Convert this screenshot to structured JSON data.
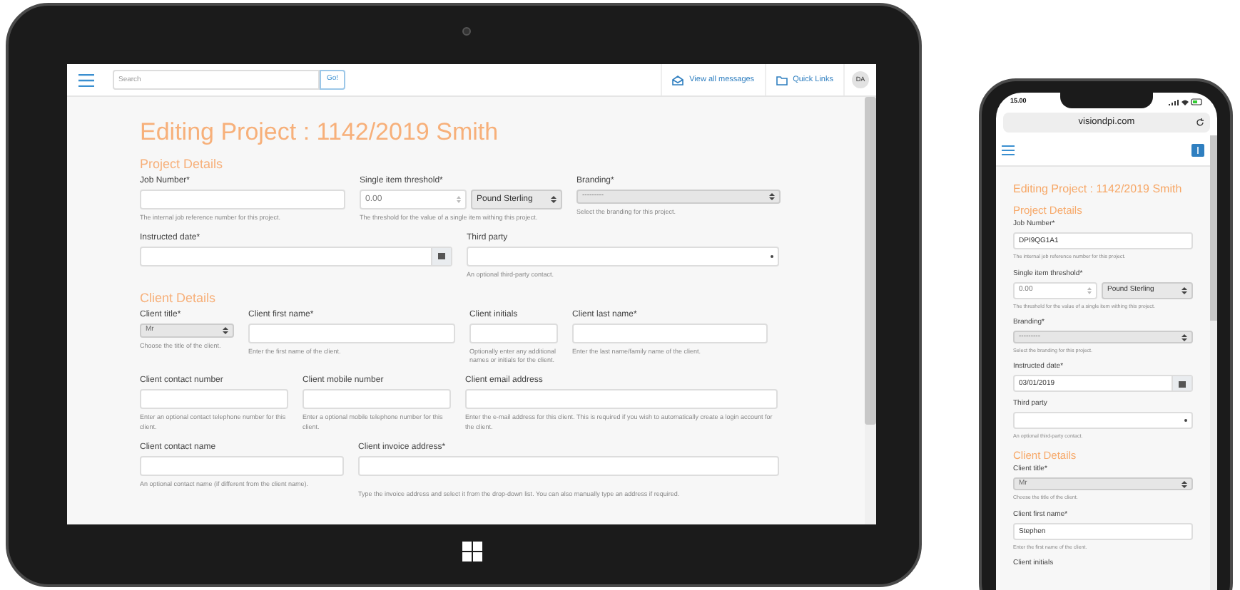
{
  "tablet": {
    "top_bar": {
      "search": {
        "placeholder": "Search"
      },
      "go_button": "Go!",
      "messages_link": "View all messages",
      "quick_links": "Quick Links",
      "avatar": "DA"
    },
    "page_title": "Editing Project : 1142/2019 Smith",
    "sections": [
      {
        "heading": "Project Details",
        "rows": [
          [
            {
              "kind": "text",
              "label": "Job Number*",
              "help": "The internal job reference number for this project."
            },
            {
              "kind": "amount",
              "label": "Single item threshold*",
              "placeholder": "0.00",
              "currency": "Pound Sterling",
              "help": "The threshold for the value of a single item withing this project."
            },
            {
              "kind": "select",
              "label": "Branding*",
              "value": "---------",
              "help": "Select the branding for this project."
            }
          ],
          [
            {
              "kind": "date",
              "label": "Instructed date*"
            },
            {
              "kind": "combo",
              "label": "Third party",
              "help": "An optional third-party contact."
            }
          ]
        ]
      },
      {
        "heading": "Client Details",
        "rows": [
          [
            {
              "kind": "select",
              "label": "Client title*",
              "value": "Mr",
              "help": "Choose the title of the client."
            },
            {
              "kind": "text",
              "label": "Client first name*",
              "help": "Enter the first name of the client."
            },
            {
              "kind": "text",
              "label": "Client initials",
              "help": "Optionally enter any additional names or initials for the client."
            },
            {
              "kind": "text",
              "label": "Client last name*",
              "help": "Enter the last name/family name of the client."
            }
          ],
          [
            {
              "kind": "text",
              "label": "Client contact number",
              "help": "Enter an optional contact telephone number for this client."
            },
            {
              "kind": "text",
              "label": "Client mobile number",
              "help": "Enter a optional mobile telephone number for this client."
            },
            {
              "kind": "text",
              "label": "Client email address",
              "help": "Enter the e-mail address for this client. This is required if you wish to automatically create a login account for the client."
            }
          ],
          [
            {
              "kind": "text",
              "label": "Client contact name",
              "help": "An optional contact name (if different from the client name)."
            },
            {
              "kind": "address",
              "label": "Client invoice address*",
              "help": "Type the invoice address and select it from the drop-down list. You can also manually type an address if required."
            }
          ]
        ]
      }
    ]
  },
  "phone": {
    "status_time": "15.00",
    "url": "visiondpi.com",
    "page_title": "Editing Project : 1142/2019 Smith",
    "sections": [
      {
        "heading": "Project Details",
        "fields": [
          {
            "kind": "text",
            "label": "Job Number*",
            "value": "DPI9QG1A1",
            "help": "The internal job reference number for this project."
          },
          {
            "kind": "amount",
            "label": "Single item threshold*",
            "placeholder": "0.00",
            "currency": "Pound Sterling",
            "help": "The threshold for the value of a single item withing this project."
          },
          {
            "kind": "select",
            "label": "Branding*",
            "value": "---------",
            "help": "Select the branding for this project."
          },
          {
            "kind": "date",
            "label": "Instructed date*",
            "value": "03/01/2019"
          },
          {
            "kind": "combo",
            "label": "Third party",
            "help": "An optional third-party contact."
          }
        ]
      },
      {
        "heading": "Client Details",
        "fields": [
          {
            "kind": "select",
            "label": "Client title*",
            "value": "Mr",
            "help": "Choose the title of the client."
          },
          {
            "kind": "text",
            "label": "Client first name*",
            "value": "Stephen",
            "help": "Enter the first name of the client."
          },
          {
            "kind": "label",
            "label": "Client initials"
          }
        ]
      }
    ]
  }
}
